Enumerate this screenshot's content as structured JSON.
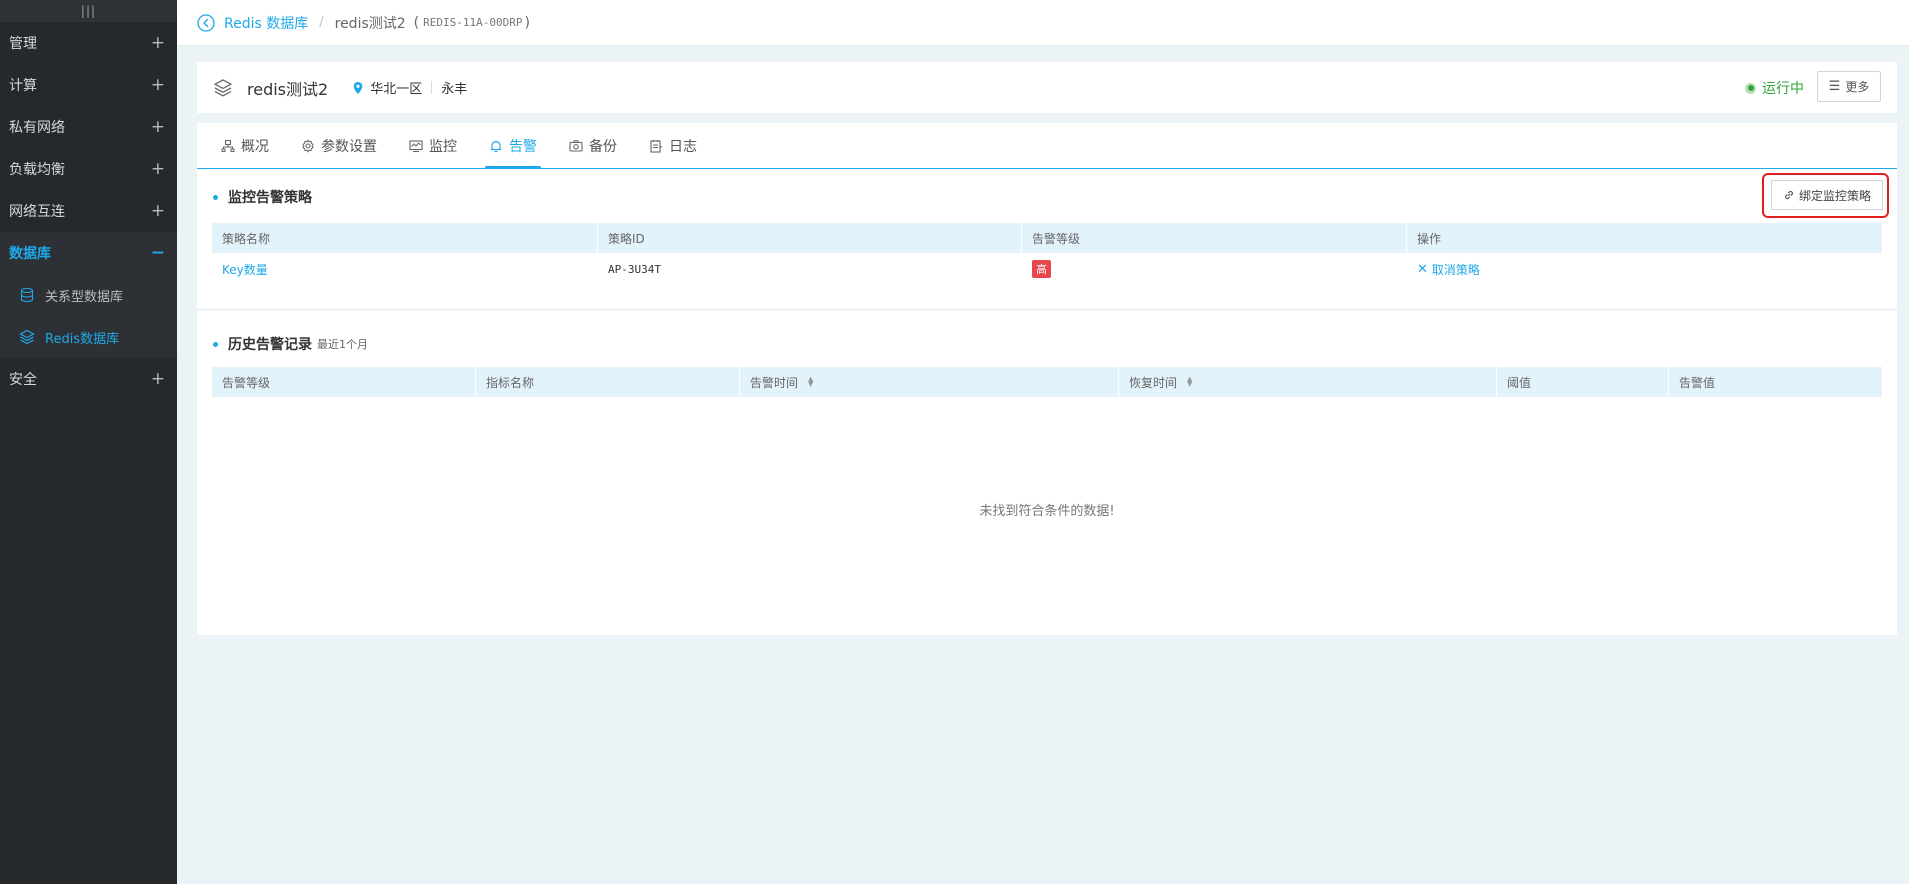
{
  "sidebar": {
    "handle": "|||",
    "items": [
      {
        "label": "管理",
        "toggle": "+"
      },
      {
        "label": "计算",
        "toggle": "+"
      },
      {
        "label": "私有网络",
        "toggle": "+"
      },
      {
        "label": "负载均衡",
        "toggle": "+"
      },
      {
        "label": "网络互连",
        "toggle": "+"
      },
      {
        "label": "数据库",
        "toggle": "−"
      },
      {
        "label": "安全",
        "toggle": "+"
      }
    ],
    "sub_items": [
      {
        "label": "关系型数据库",
        "icon": "database-icon"
      },
      {
        "label": "Redis数据库",
        "icon": "layers-icon"
      }
    ]
  },
  "breadcrumb": {
    "parent": "Redis 数据库",
    "separator": "/",
    "current": "redis测试2",
    "paren_open": "(",
    "id": "REDIS-11A-00DRP",
    "paren_close": ")"
  },
  "instance": {
    "name": "redis测试2",
    "region": "华北一区",
    "zone": "永丰",
    "status": "运行中",
    "more_label": "更多"
  },
  "tabs": [
    {
      "label": "概况",
      "icon": "overview-icon"
    },
    {
      "label": "参数设置",
      "icon": "settings-icon"
    },
    {
      "label": "监控",
      "icon": "monitor-icon"
    },
    {
      "label": "告警",
      "icon": "bell-icon"
    },
    {
      "label": "备份",
      "icon": "camera-icon"
    },
    {
      "label": "日志",
      "icon": "log-icon"
    }
  ],
  "policy_section": {
    "title": "监控告警策略",
    "bind_label": "绑定监控策略",
    "columns": [
      "策略名称",
      "策略ID",
      "告警等级",
      "操作"
    ],
    "rows": [
      {
        "name": "Key数量",
        "id": "AP-3U34T",
        "level": "高",
        "action": "取消策略"
      }
    ]
  },
  "history_section": {
    "title": "历史告警记录",
    "subtitle": "最近1个月",
    "columns": [
      "告警等级",
      "指标名称",
      "告警时间",
      "恢复时间",
      "阈值",
      "告警值"
    ],
    "empty_text": "未找到符合条件的数据!"
  },
  "colors": {
    "accent": "#1fa9e8",
    "sidebar_bg": "#26292c",
    "status_green": "#31a53a",
    "badge_red": "#e8474b",
    "highlight": "#e02020"
  }
}
